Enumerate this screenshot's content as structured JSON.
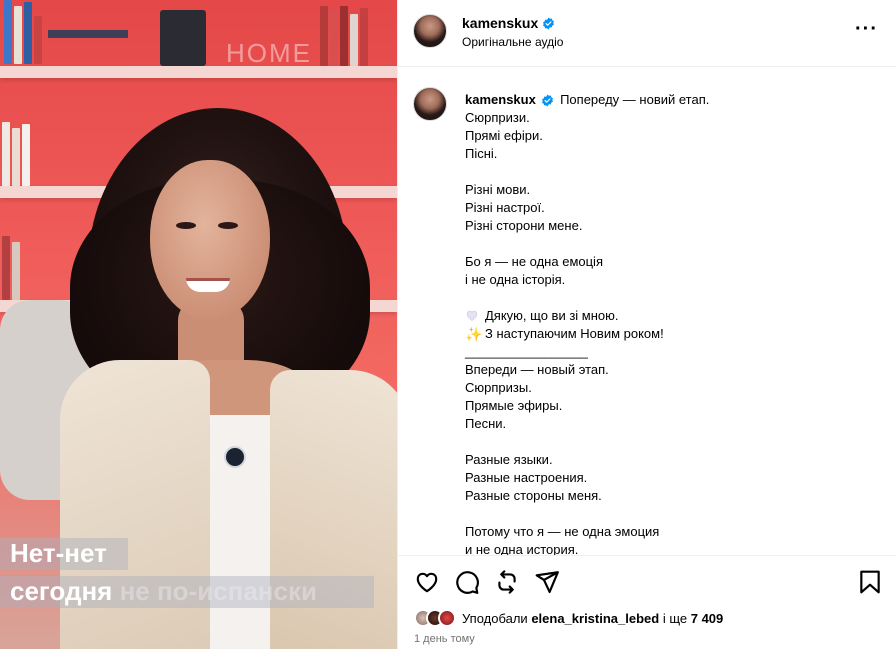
{
  "media": {
    "caption_line1": "Нет-нет",
    "caption_line2_a": "сегодня ",
    "caption_line2_b": "не по-испански",
    "sign_text": "HOME"
  },
  "header": {
    "username": "kamenskux",
    "audio": "Оригінальне аудіо",
    "more_icon": "more-horizontal-icon"
  },
  "caption": {
    "username": "kamenskux",
    "first_line": "Попереду — новий етап.",
    "lines": [
      "Сюрпризи.",
      "Прямі ефіри.",
      "Пісні.",
      "",
      "Різні мови.",
      "Різні настрої.",
      "Різні сторони мене.",
      "",
      "Бо я — не одна емоція",
      "і не одна історія.",
      ""
    ],
    "thanks": "Дякую, що ви зі мною.",
    "new_year": "З наступаючим Новим роком!",
    "divider": "_________________",
    "ru_lines": [
      "Впереди — новый этап.",
      "Сюрпризы.",
      "Прямые эфиры.",
      "Песни.",
      "",
      "Разные языки.",
      "Разные настроения.",
      "Разные стороны меня.",
      "",
      "Потому что я — не одна эмоция",
      "и не одна история."
    ]
  },
  "actions": {
    "like": "heart-icon",
    "comment": "comment-icon",
    "repost": "repost-icon",
    "share": "share-icon",
    "save": "bookmark-icon"
  },
  "likes": {
    "prefix": "Уподобали ",
    "user": "elena_kristina_lebed",
    "middle": " і ще ",
    "count": "7 409"
  },
  "time": "1 день тому",
  "colors": {
    "verified": "#0095f6",
    "muted": "#737373",
    "border": "#efefef"
  }
}
